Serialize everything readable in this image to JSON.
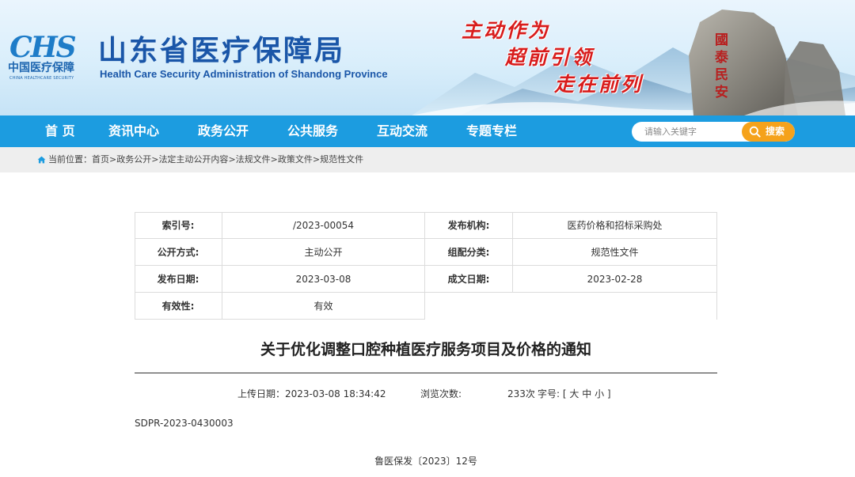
{
  "header": {
    "logo_mark": "CHS",
    "logo_cn": "中国医疗保障",
    "logo_en": "CHINA HEALTHCARE SECURITY",
    "site_title": "山东省医疗保障局",
    "site_subtitle": "Health Care Security Administration of Shandong Province",
    "slogans": [
      "主动作为",
      "超前引领",
      "走在前列"
    ]
  },
  "nav": {
    "items": [
      {
        "label": "首 页"
      },
      {
        "label": "资讯中心"
      },
      {
        "label": "政务公开"
      },
      {
        "label": "公共服务"
      },
      {
        "label": "互动交流"
      },
      {
        "label": "专题专栏"
      }
    ]
  },
  "search": {
    "placeholder": "请输入关键字",
    "button_label": "搜索"
  },
  "breadcrumb": {
    "prefix": "当前位置：",
    "items": [
      "首页",
      "政务公开",
      "法定主动公开内容",
      "法规文件",
      "政策文件",
      "规范性文件"
    ],
    "separator": ">"
  },
  "info_table": {
    "index_label": "索引号:",
    "index_value": "/2023-00054",
    "issuer_label": "发布机构:",
    "issuer_value": "医药价格和招标采购处",
    "disclosure_label": "公开方式:",
    "disclosure_value": "主动公开",
    "category_label": "组配分类:",
    "category_value": "规范性文件",
    "publish_date_label": "发布日期:",
    "publish_date_value": "2023-03-08",
    "written_date_label": "成文日期:",
    "written_date_value": "2023-02-28",
    "validity_label": "有效性:",
    "validity_value": "有效"
  },
  "article": {
    "title": "关于优化调整口腔种植医疗服务项目及价格的通知",
    "upload_label": "上传日期：",
    "upload_value": "2023-03-08 18:34:42",
    "views_label": "浏览次数:",
    "views_value": "233次",
    "font_size_label": "字号:",
    "font_size_open": "[",
    "font_size_large": "大",
    "font_size_medium": "中",
    "font_size_small": "小",
    "font_size_close": "]",
    "doc_code": "SDPR-2023-0430003",
    "doc_number": "鲁医保发〔2023〕12号"
  },
  "colors": {
    "nav_background": "#1c9ce0",
    "search_button": "#f5a21b",
    "title_blue": "#1a56a8",
    "slogan_red": "#d81c1c"
  }
}
